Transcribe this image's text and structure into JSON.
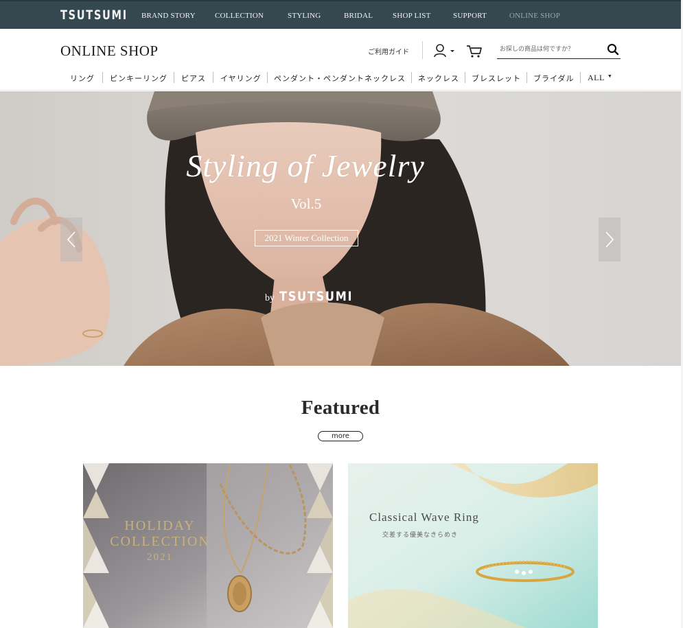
{
  "topbar": {
    "logo": "TSUTSUMI",
    "nav": [
      {
        "label": "BRAND STORY",
        "active": false
      },
      {
        "label": "COLLECTION",
        "active": false
      },
      {
        "label": "STYLING",
        "active": false
      },
      {
        "label": "BRIDAL",
        "active": false
      },
      {
        "label": "SHOP LIST",
        "active": false
      },
      {
        "label": "SUPPORT",
        "active": false
      },
      {
        "label": "ONLINE SHOP",
        "active": true
      }
    ]
  },
  "header": {
    "title": "ONLINE SHOP",
    "guide_label": "ご利用ガイド",
    "user_icon": "user-icon",
    "cart_icon": "cart-icon",
    "search": {
      "placeholder": "お探しの商品は何ですか？",
      "value": "",
      "icon": "search-icon"
    }
  },
  "categories": [
    {
      "label": "リング"
    },
    {
      "label": "ピンキーリング"
    },
    {
      "label": "ピアス"
    },
    {
      "label": "イヤリング"
    },
    {
      "label": "ペンダント・ペンダントネックレス"
    },
    {
      "label": "ネックレス"
    },
    {
      "label": "ブレスレット"
    },
    {
      "label": "ブライダル"
    },
    {
      "label": "ALL"
    }
  ],
  "hero": {
    "title": "Styling of Jewelry",
    "volume": "Vol.5",
    "badge": "2021 Winter Collection",
    "by": "by",
    "by_logo": "TSUTSUMI",
    "prev_icon": "chevron-left-icon",
    "next_icon": "chevron-right-icon"
  },
  "featured": {
    "title": "Featured",
    "more_label": "more",
    "cards": [
      {
        "line1": "HOLIDAY",
        "line2": "COLLECTION",
        "year": "2021"
      },
      {
        "title": "Classical Wave Ring",
        "subtitle": "交差する優美なきらめき"
      }
    ]
  },
  "colors": {
    "topbar_bg": "#35474f",
    "gold_text": "#c9b27a",
    "white": "#ffffff"
  }
}
